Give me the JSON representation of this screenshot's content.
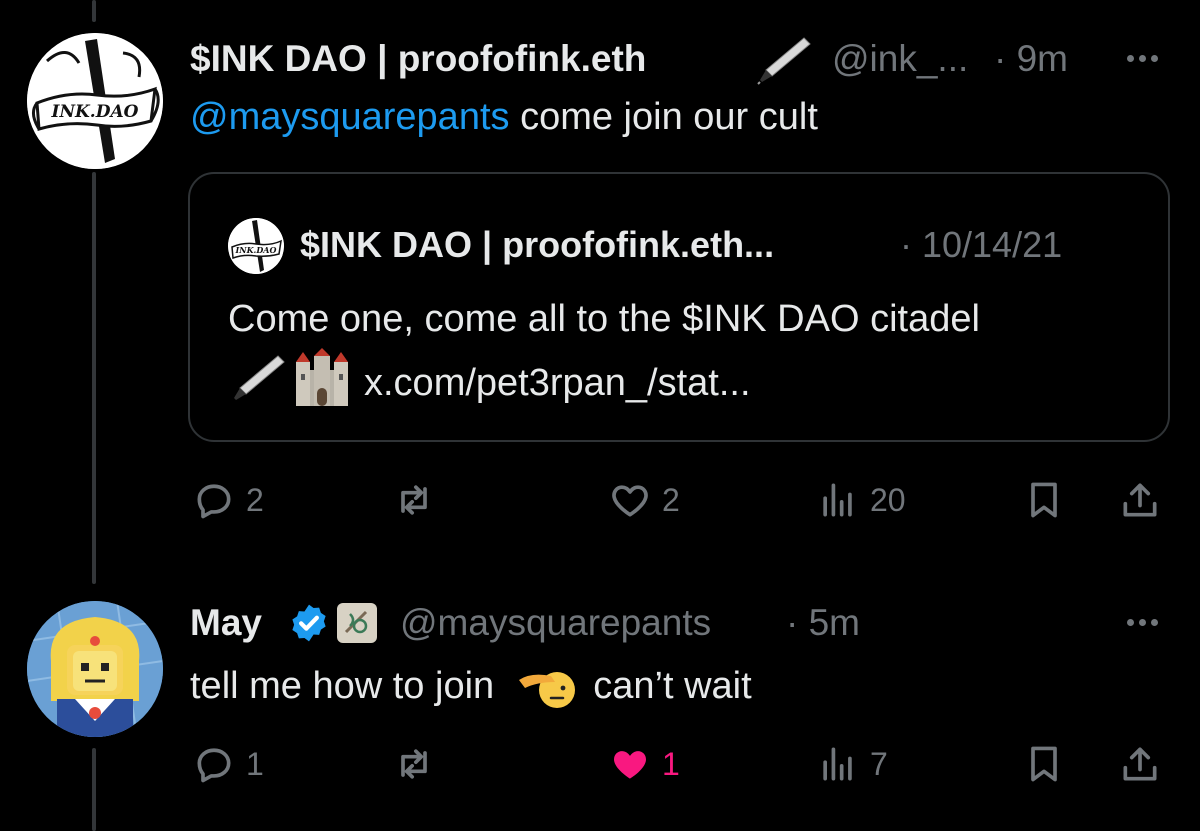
{
  "tweet1": {
    "display_name": "$INK DAO | proofofink.eth",
    "handle": "@ink_...",
    "time": "· 9m",
    "mention": "@maysquarepants",
    "text": " come join our cult",
    "avatar_text": "INK.DAO",
    "quote": {
      "display_name": "$INK DAO | proofofink.eth...",
      "time": "· 10/14/21",
      "avatar_text": "INK.DAO",
      "line1": "Come one, come all to the $INK DAO citadel",
      "link": "x.com/pet3rpan_/stat..."
    },
    "actions": {
      "replies": "2",
      "likes": "2",
      "views": "20"
    }
  },
  "tweet2": {
    "display_name": "May",
    "handle": "@maysquarepants",
    "time": "· 5m",
    "text_before": "tell me how to join",
    "text_after": "can’t wait",
    "actions": {
      "replies": "1",
      "likes": "1",
      "views": "7"
    }
  },
  "colors": {
    "background": "#000000",
    "text": "#e7e9ea",
    "secondary": "#71767b",
    "accent": "#1d9bf0",
    "like": "#f91880"
  },
  "icons": [
    "pen-icon",
    "castle-emoji-icon",
    "verified-badge-icon",
    "saluting-face-emoji-icon",
    "reply-icon",
    "retweet-icon",
    "like-icon",
    "views-icon",
    "bookmark-icon",
    "share-icon",
    "more-icon"
  ]
}
